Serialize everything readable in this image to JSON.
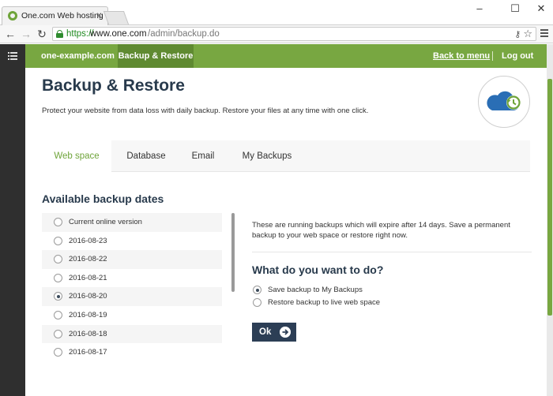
{
  "browser": {
    "tab_title": "One.com Web hosting",
    "tab_close": "×",
    "url_scheme": "https://",
    "url_host": "www.one.com",
    "url_path": "/admin/backup.do",
    "minimize": "–",
    "maximize": "☐",
    "close": "✕",
    "back": "←",
    "forward": "→",
    "reload": "↻",
    "key_icon_glyph": "⚷",
    "star_icon_glyph": "☆"
  },
  "topnav": {
    "brand": "one-example.com",
    "active": "Backup & Restore",
    "back_link": "Back to menu",
    "logout": "Log out"
  },
  "header": {
    "title": "Backup & Restore",
    "subtitle": "Protect your website from data loss with daily backup. Restore your files at any time with one click."
  },
  "tabs": [
    {
      "label": "Web space",
      "active": true
    },
    {
      "label": "Database",
      "active": false
    },
    {
      "label": "Email",
      "active": false
    },
    {
      "label": "My Backups",
      "active": false
    }
  ],
  "dates": {
    "heading": "Available backup dates",
    "items": [
      {
        "label": "Current online version",
        "selected": false
      },
      {
        "label": "2016-08-23",
        "selected": false
      },
      {
        "label": "2016-08-22",
        "selected": false
      },
      {
        "label": "2016-08-21",
        "selected": false
      },
      {
        "label": "2016-08-20",
        "selected": true
      },
      {
        "label": "2016-08-19",
        "selected": false
      },
      {
        "label": "2016-08-18",
        "selected": false
      },
      {
        "label": "2016-08-17",
        "selected": false
      }
    ]
  },
  "panel": {
    "info": "These are running backups which will expire after 14 days. Save a permanent backup to your web space or restore right now.",
    "question": "What do you want to do?",
    "options": [
      {
        "label": "Save backup to My Backups",
        "selected": true
      },
      {
        "label": "Restore backup to live web space",
        "selected": false
      }
    ],
    "ok_label": "Ok"
  },
  "colors": {
    "accent_green": "#78a741",
    "nav_active": "#5f8a31",
    "heading": "#283a4c",
    "button": "#2c3e55",
    "hero_cloud": "#2a6eb5"
  }
}
